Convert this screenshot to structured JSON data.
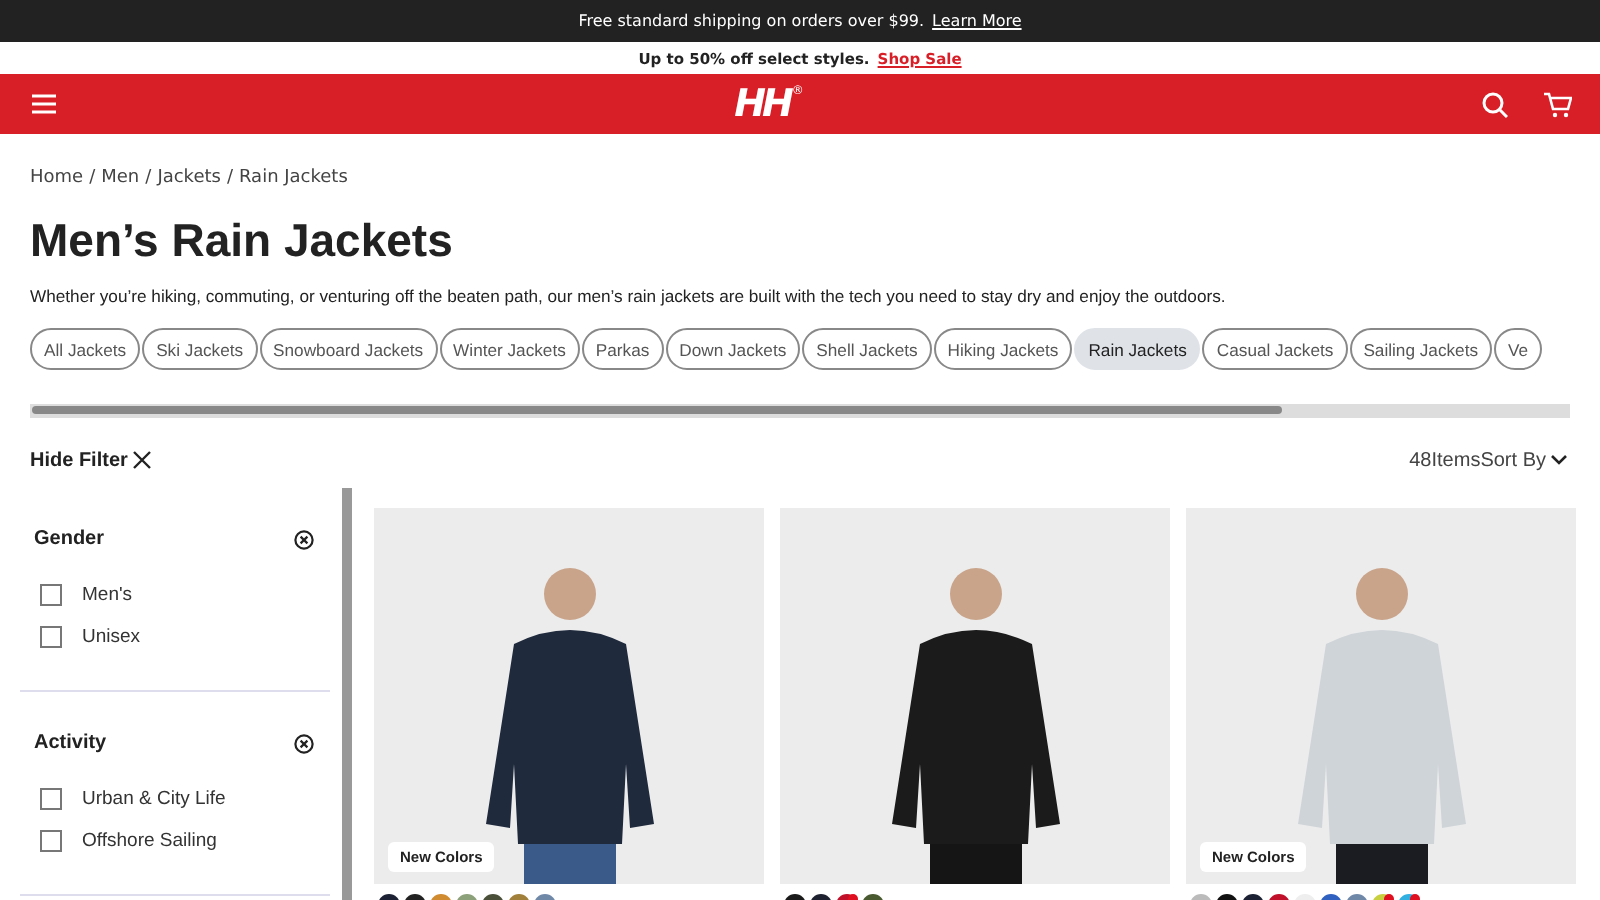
{
  "announcement": {
    "text": "Free standard shipping on orders over $99.",
    "link": "Learn More"
  },
  "promo": {
    "text": "Up to 50% off select styles.",
    "link": "Shop Sale"
  },
  "header": {
    "logo": "HH",
    "logo_mark": "®"
  },
  "breadcrumb": {
    "separator": "/",
    "items": [
      "Home",
      "Men",
      "Jackets",
      "Rain Jackets"
    ]
  },
  "title": "Men’s Rain Jackets",
  "description": "Whether you’re hiking, commuting, or venturing off the beaten path, our men’s rain jackets are built with the tech you need to stay dry and enjoy the outdoors.",
  "categories": [
    {
      "label": "All Jackets",
      "selected": false
    },
    {
      "label": "Ski Jackets",
      "selected": false
    },
    {
      "label": "Snowboard Jackets",
      "selected": false
    },
    {
      "label": "Winter Jackets",
      "selected": false
    },
    {
      "label": "Parkas",
      "selected": false
    },
    {
      "label": "Down Jackets",
      "selected": false
    },
    {
      "label": "Shell Jackets",
      "selected": false
    },
    {
      "label": "Hiking Jackets",
      "selected": false
    },
    {
      "label": "Rain Jackets",
      "selected": true
    },
    {
      "label": "Casual Jackets",
      "selected": false
    },
    {
      "label": "Sailing Jackets",
      "selected": false
    },
    {
      "label": "Ve",
      "selected": false
    }
  ],
  "toolbar": {
    "hide_filter": "Hide Filter",
    "count": "48Items",
    "sort": "Sort By"
  },
  "filters": [
    {
      "title": "Gender",
      "options": [
        {
          "label": "Men's",
          "checked": false
        },
        {
          "label": "Unisex",
          "checked": false
        }
      ]
    },
    {
      "title": "Activity",
      "options": [
        {
          "label": "Urban & City Life",
          "checked": false
        },
        {
          "label": "Offshore Sailing",
          "checked": false
        }
      ]
    }
  ],
  "products": [
    {
      "badge": "New Colors",
      "swatches": [
        {
          "color": "#1c2233",
          "sale": false
        },
        {
          "color": "#222222",
          "sale": false
        },
        {
          "color": "#d08a30",
          "sale": false
        },
        {
          "color": "#8ca07a",
          "sale": false
        },
        {
          "color": "#4a4f3a",
          "sale": false
        },
        {
          "color": "#a0803a",
          "sale": false
        },
        {
          "color": "#7088a8",
          "sale": false
        }
      ]
    },
    {
      "swatches": [
        {
          "color": "#1a1a1a",
          "sale": false
        },
        {
          "color": "#1e2230",
          "sale": false
        },
        {
          "color": "#c0102a",
          "sale": true
        },
        {
          "color": "#4a5a30",
          "sale": false
        }
      ]
    },
    {
      "badge": "New Colors",
      "swatches": [
        {
          "color": "#bbbbbb",
          "sale": false
        },
        {
          "color": "#111111",
          "sale": false
        },
        {
          "color": "#1c2233",
          "sale": false
        },
        {
          "color": "#c0102a",
          "sale": false
        },
        {
          "color": "#eeeeee",
          "sale": false
        },
        {
          "color": "#3060c0",
          "sale": false
        },
        {
          "color": "#7088a8",
          "sale": false
        },
        {
          "color": "#c8d040",
          "sale": true
        },
        {
          "color": "#30b0e0",
          "sale": true
        }
      ]
    }
  ]
}
